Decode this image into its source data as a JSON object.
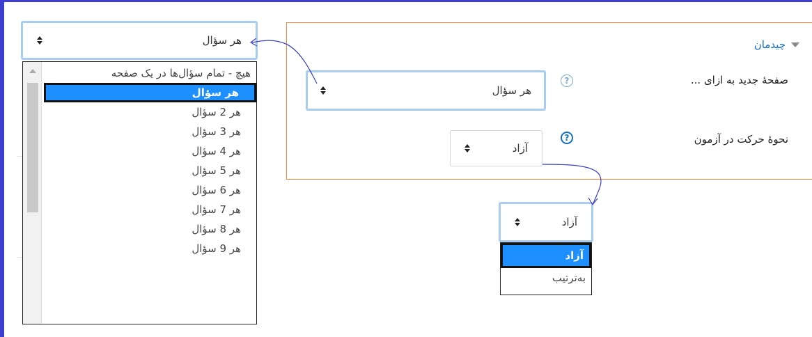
{
  "layout_section": {
    "title": "چیدمان",
    "new_page": {
      "label": "صفحهٔ جدید به ازای ...",
      "value": "هر سؤال"
    },
    "navigation": {
      "label": "نحوهٔ حرکت در آزمون",
      "value": "آزاد"
    }
  },
  "new_page_dropdown": {
    "value": "هر سؤال",
    "options": [
      "هیچ - تمام سؤال‌ها در یک صفحه",
      "هر سؤال",
      "هر 2 سؤال",
      "هر 3 سؤال",
      "هر 4 سؤال",
      "هر 5 سؤال",
      "هر 6 سؤال",
      "هر 7 سؤال",
      "هر 8 سؤال",
      "هر 9 سؤال"
    ],
    "selected_index": 1
  },
  "navigation_dropdown": {
    "value": "آزاد",
    "options": [
      "آزاد",
      "به‌ترتیب"
    ],
    "selected_index": 0
  },
  "colors": {
    "frame": "#3d3fd0",
    "panel_border": "#f0883e",
    "link": "#0f6fc5",
    "selected_option": "#1e8fff",
    "annotation_arrow": "#3a3fc4"
  }
}
